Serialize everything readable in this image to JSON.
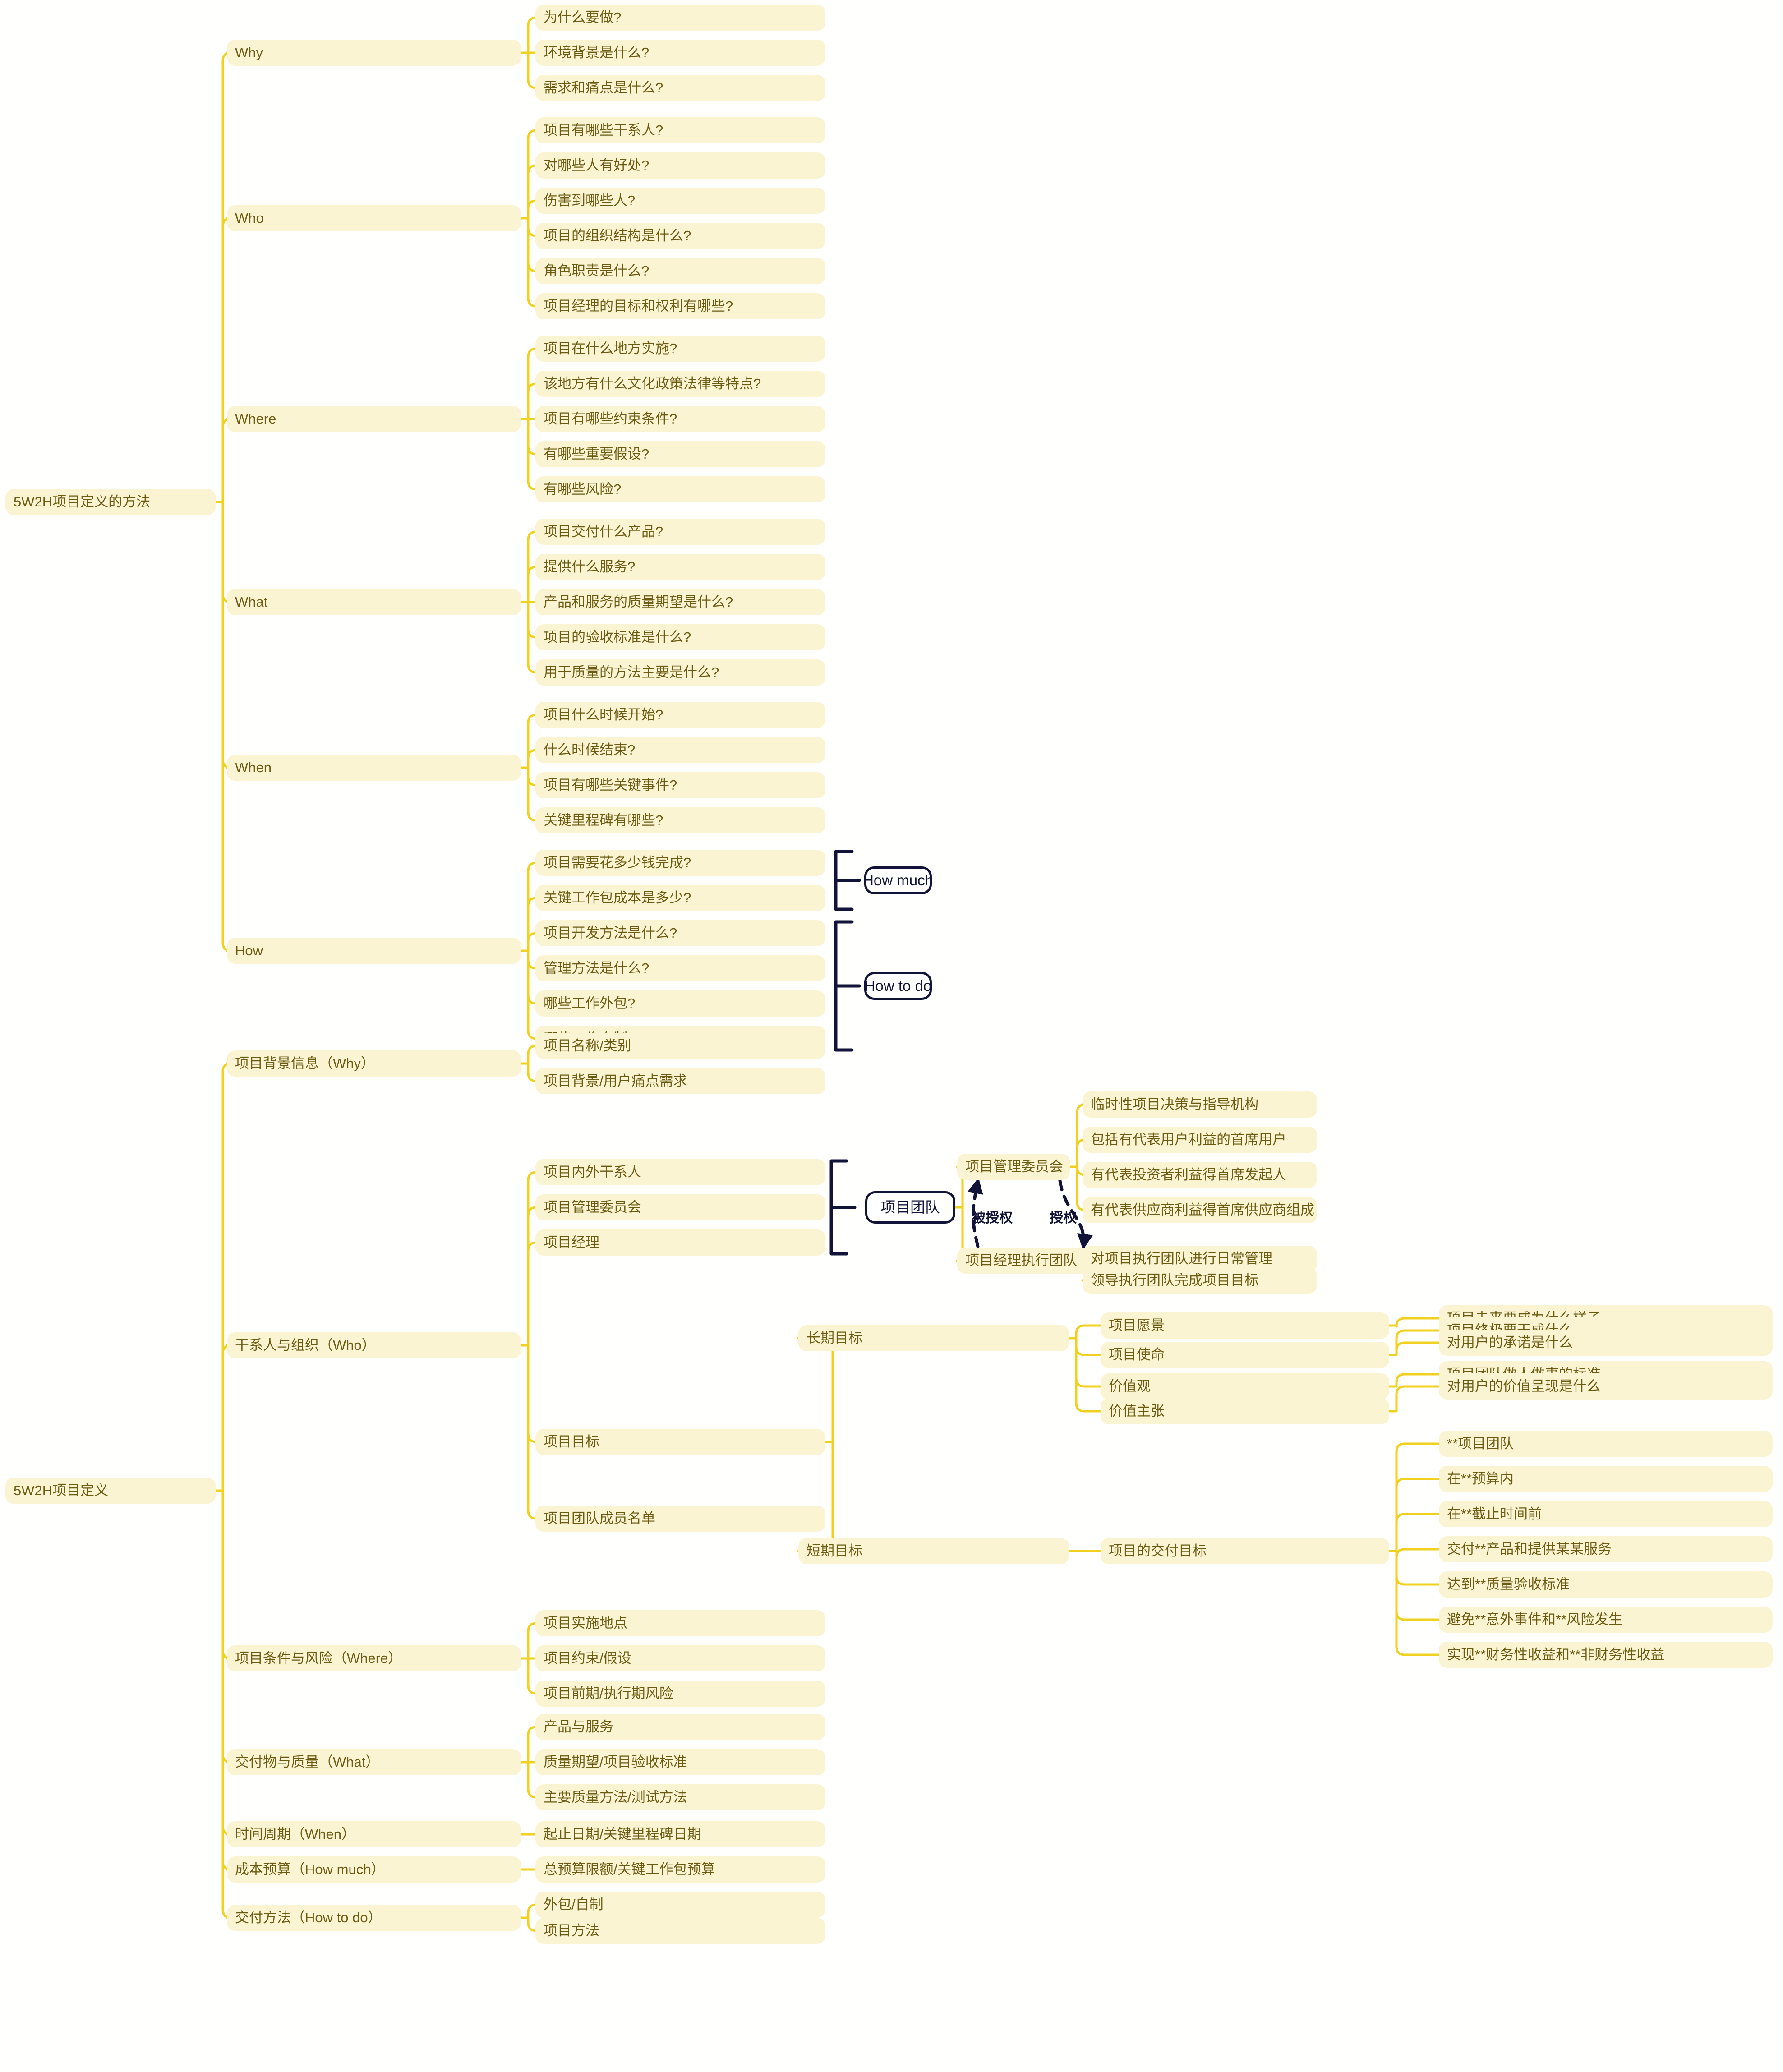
{
  "palette": {
    "node_fill": "#fbf4d3",
    "node_text": "#6b5a10",
    "link": "#f1d01e",
    "dark_stroke": "#111338",
    "background": "#fffffe"
  },
  "tree1": {
    "root": "5W2H项目定义的方法",
    "branches": [
      {
        "label": "Why",
        "children": [
          "为什么要做?",
          "环境背景是什么?",
          "需求和痛点是什么?"
        ]
      },
      {
        "label": "Who",
        "children": [
          "项目有哪些干系人?",
          "对哪些人有好处?",
          "伤害到哪些人?",
          "项目的组织结构是什么?",
          "角色职责是什么?",
          "项目经理的目标和权利有哪些?"
        ]
      },
      {
        "label": "Where",
        "children": [
          "项目在什么地方实施?",
          "该地方有什么文化政策法律等特点?",
          "项目有哪些约束条件?",
          "有哪些重要假设?",
          "有哪些风险?"
        ]
      },
      {
        "label": "What",
        "children": [
          "项目交付什么产品?",
          "提供什么服务?",
          "产品和服务的质量期望是什么?",
          "项目的验收标准是什么?",
          "用于质量的方法主要是什么?"
        ]
      },
      {
        "label": "When",
        "children": [
          "项目什么时候开始?",
          "什么时候结束?",
          "项目有哪些关键事件?",
          "关键里程碑有哪些?"
        ]
      },
      {
        "label": "How",
        "children": [
          "项目需要花多少钱完成?",
          "关键工作包成本是多少?",
          "项目开发方法是什么?",
          "管理方法是什么?",
          "哪些工作外包?",
          "哪些工作自制?"
        ]
      }
    ],
    "groups": [
      {
        "label": "How much",
        "covers": [
          0,
          1
        ]
      },
      {
        "label": "How to do",
        "covers": [
          2,
          5
        ]
      }
    ]
  },
  "tree2": {
    "root": "5W2H项目定义",
    "branches": [
      {
        "label": "项目背景信息（Why）",
        "children": [
          {
            "label": "项目名称/类别"
          },
          {
            "label": "项目背景/用户痛点需求"
          }
        ]
      },
      {
        "label": "干系人与组织（Who）",
        "children": [
          {
            "label": "项目内外干系人"
          },
          {
            "label": "项目管理委员会"
          },
          {
            "label": "项目经理"
          },
          {
            "label": "项目目标"
          },
          {
            "label": "项目团队成员名单"
          }
        ]
      },
      {
        "label": "项目条件与风险（Where）",
        "children": [
          {
            "label": "项目实施地点"
          },
          {
            "label": "项目约束/假设"
          },
          {
            "label": "项目前期/执行期风险"
          }
        ]
      },
      {
        "label": "交付物与质量（What）",
        "children": [
          {
            "label": "产品与服务"
          },
          {
            "label": "质量期望/项目验收标准"
          },
          {
            "label": "主要质量方法/测试方法"
          }
        ]
      },
      {
        "label": "时间周期（When）",
        "children": [
          {
            "label": "起止日期/关键里程碑日期"
          }
        ]
      },
      {
        "label": "成本预算（How much）",
        "children": [
          {
            "label": "总预算限额/关键工作包预算"
          }
        ]
      },
      {
        "label": "交付方法（How to do）",
        "children": [
          {
            "label": "外包/自制"
          },
          {
            "label": "项目方法"
          }
        ]
      }
    ],
    "team_group": {
      "label": "项目团队",
      "covers": [
        "项目内外干系人",
        "项目经理"
      ]
    },
    "team_cluster": {
      "committee": "项目管理委员会",
      "exec_team": "项目经理执行团队",
      "arrow_label_left": "被授权",
      "arrow_label_right": "授权",
      "committee_children": [
        "临时性项目决策与指导机构",
        "包括有代表用户利益的首席用户",
        "有代表投资者利益得首席发起人",
        "有代表供应商利益得首席供应商组成"
      ],
      "exec_children": [
        "对项目执行团队进行日常管理",
        "领导执行团队完成项目目标"
      ]
    },
    "goals": {
      "long_term": {
        "label": "长期目标",
        "children": [
          {
            "label": "项目愿景",
            "children": [
              "项目未来要成为什么样子"
            ]
          },
          {
            "label": "项目使命",
            "children": [
              "项目终极要干成什么",
              "对用户的承诺是什么"
            ]
          },
          {
            "label": "价值观",
            "children": [
              "项目团队做人做事的标准"
            ]
          },
          {
            "label": "价值主张",
            "children": [
              "对用户的价值呈现是什么"
            ]
          }
        ]
      },
      "short_term": {
        "label": "短期目标",
        "children": [
          {
            "label": "项目的交付目标",
            "children": [
              "**项目团队",
              "在**预算内",
              "在**截止时间前",
              "交付**产品和提供某某服务",
              "达到**质量验收标准",
              "避免**意外事件和**风险发生",
              "实现**财务性收益和**非财务性收益"
            ]
          }
        ]
      }
    }
  }
}
